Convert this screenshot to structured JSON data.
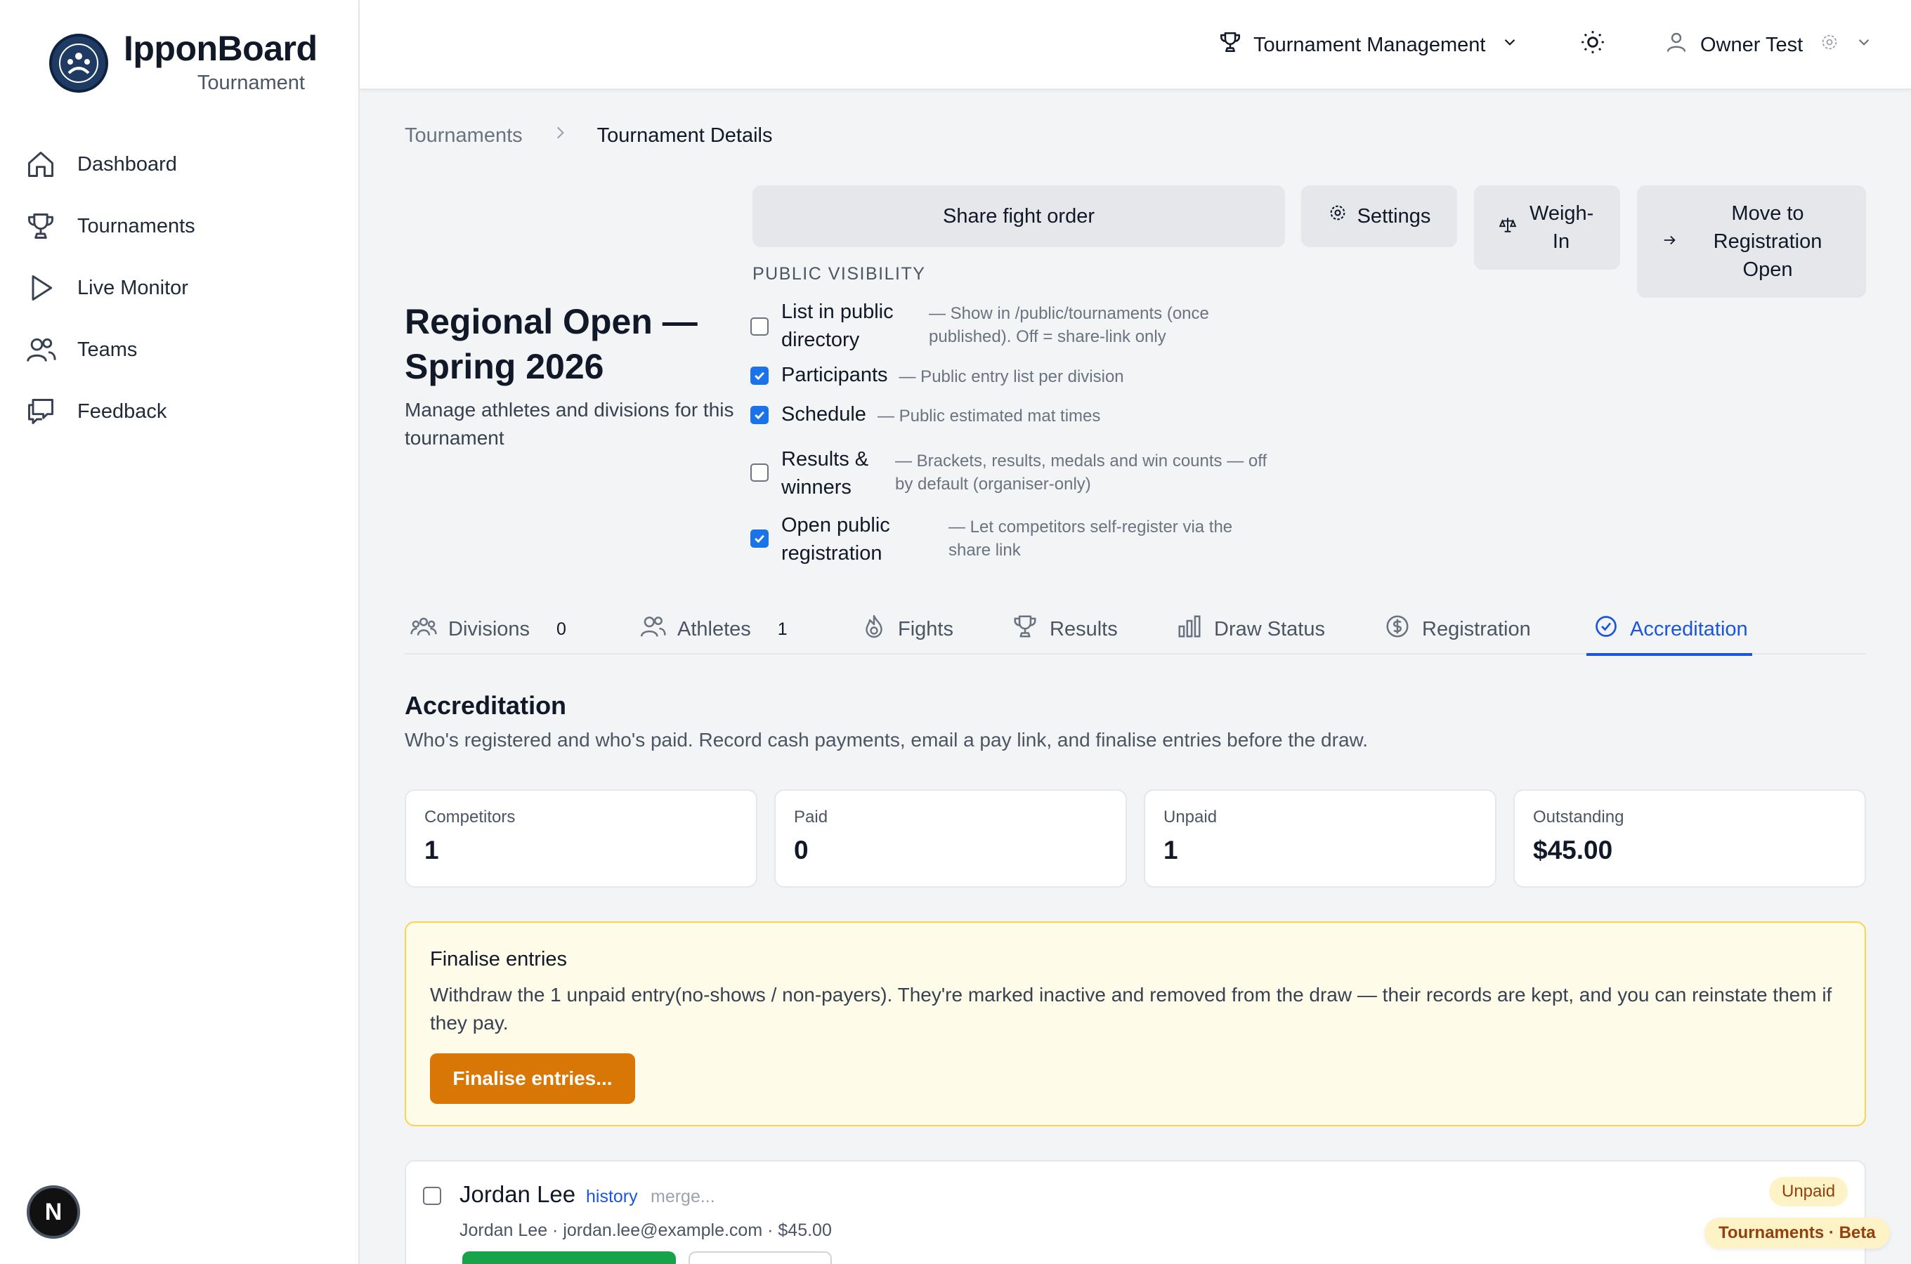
{
  "app": {
    "name": "IpponBoard",
    "subtitle": "Tournament",
    "dev_badge": "N"
  },
  "sidebar": {
    "items": [
      {
        "label": "Dashboard",
        "icon": "home-icon"
      },
      {
        "label": "Tournaments",
        "icon": "trophy-icon"
      },
      {
        "label": "Live Monitor",
        "icon": "play-icon"
      },
      {
        "label": "Teams",
        "icon": "users-icon"
      },
      {
        "label": "Feedback",
        "icon": "chat-icon"
      }
    ]
  },
  "header": {
    "menu_label": "Tournament Management",
    "user_name": "Owner Test"
  },
  "breadcrumb": {
    "parent": "Tournaments",
    "current": "Tournament Details"
  },
  "actions": {
    "share": "Share fight order",
    "settings": "Settings",
    "weigh_in": "Weigh-In",
    "move_to": "Move to Registration Open"
  },
  "tournament": {
    "title": "Regional Open — Spring 2026",
    "description": "Manage athletes and divisions for this tournament"
  },
  "visibility": {
    "heading": "PUBLIC VISIBILITY",
    "options": [
      {
        "label": "List in public directory",
        "desc": "— Show in /public/tournaments (once published). Off = share-link only",
        "checked": false
      },
      {
        "label": "Participants",
        "desc": "— Public entry list per division",
        "checked": true
      },
      {
        "label": "Schedule",
        "desc": "— Public estimated mat times",
        "checked": true
      },
      {
        "label": "Results & winners",
        "desc": "— Brackets, results, medals and win counts — off by default (organiser-only)",
        "checked": false
      },
      {
        "label": "Open public registration",
        "desc": "— Let competitors self-register via the share link",
        "checked": true
      }
    ]
  },
  "tabs": [
    {
      "label": "Divisions",
      "count": "0"
    },
    {
      "label": "Athletes",
      "count": "1"
    },
    {
      "label": "Fights"
    },
    {
      "label": "Results"
    },
    {
      "label": "Draw Status"
    },
    {
      "label": "Registration"
    },
    {
      "label": "Accreditation",
      "active": true
    }
  ],
  "accreditation": {
    "title": "Accreditation",
    "subtitle": "Who's registered and who's paid. Record cash payments, email a pay link, and finalise entries before the draw.",
    "stats": [
      {
        "label": "Competitors",
        "value": "1"
      },
      {
        "label": "Paid",
        "value": "0"
      },
      {
        "label": "Unpaid",
        "value": "1"
      },
      {
        "label": "Outstanding",
        "value": "$45.00"
      }
    ],
    "finalise": {
      "heading": "Finalise entries",
      "text": "Withdraw the 1 unpaid entry(no-shows / non-payers). They're marked inactive and removed from the draw — their records are kept, and you can reinstate them if they pay.",
      "button": "Finalise entries..."
    },
    "entry": {
      "name": "Jordan Lee",
      "history_link": "history",
      "merge_link": "merge...",
      "details": "Jordan Lee · jordan.lee@example.com · $45.00",
      "status": "Unpaid"
    }
  },
  "footer_badge": "Tournaments · Beta",
  "colors": {
    "accent": "#1a56db",
    "checkbox": "#1a73e8",
    "warning_bg": "#fefce8",
    "warning_border": "#fcd34d",
    "orange_button": "#d97706",
    "green_button": "#16a34a"
  }
}
